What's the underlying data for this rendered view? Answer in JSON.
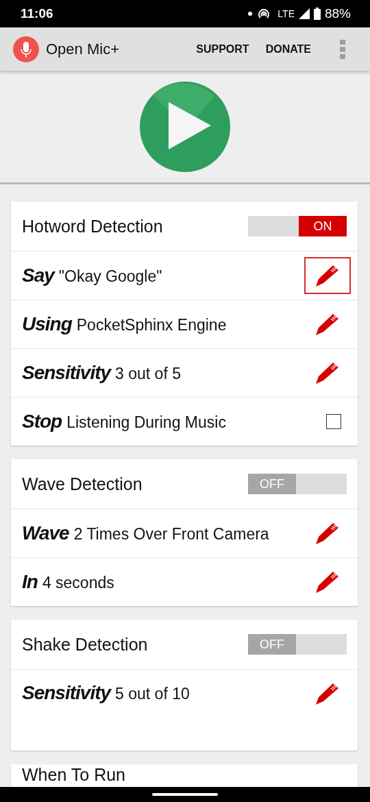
{
  "status_bar": {
    "time": "11:06",
    "network": "LTE",
    "battery": "88%"
  },
  "app_bar": {
    "title": "Open Mic+",
    "actions": [
      "SUPPORT",
      "DONATE"
    ]
  },
  "sections": [
    {
      "title": "Hotword Detection",
      "toggle": {
        "on": true,
        "label": "ON"
      },
      "rows": [
        {
          "kind": "edit",
          "label": "Say",
          "value": "\"Okay Google\"",
          "focused": true
        },
        {
          "kind": "edit",
          "label": "Using",
          "value": "PocketSphinx Engine",
          "focused": false
        },
        {
          "kind": "edit",
          "label": "Sensitivity",
          "value": "3 out of 5",
          "focused": false
        },
        {
          "kind": "checkbox",
          "label": "Stop",
          "value": "Listening During Music",
          "checked": false
        }
      ]
    },
    {
      "title": "Wave Detection",
      "toggle": {
        "on": false,
        "label": "OFF"
      },
      "rows": [
        {
          "kind": "edit",
          "label": "Wave",
          "value": "2 Times Over Front Camera",
          "focused": false
        },
        {
          "kind": "edit",
          "label": "In",
          "value": "4 seconds",
          "focused": false
        }
      ]
    },
    {
      "title": "Shake Detection",
      "toggle": {
        "on": false,
        "label": "OFF"
      },
      "rows": [
        {
          "kind": "edit",
          "label": "Sensitivity",
          "value": "5 out of 10",
          "focused": false,
          "tall": true
        }
      ]
    }
  ],
  "next_section": {
    "title": "When To Run"
  }
}
